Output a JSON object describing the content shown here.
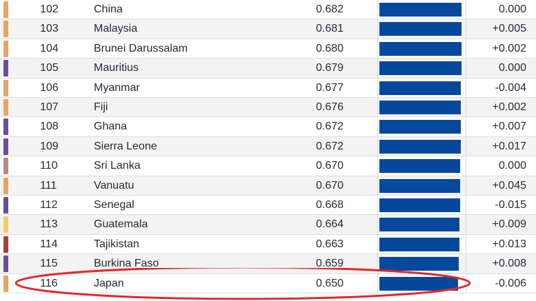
{
  "rows": [
    {
      "rank": "102",
      "country": "China",
      "score": "0.682",
      "change": "0.000",
      "accent": "#e8a65b",
      "bar_fill": 0.682
    },
    {
      "rank": "103",
      "country": "Malaysia",
      "score": "0.681",
      "change": "+0.005",
      "accent": "#e8a65b",
      "bar_fill": 0.681
    },
    {
      "rank": "104",
      "country": "Brunei Darussalam",
      "score": "0.680",
      "change": "+0.002",
      "accent": "#e8a65b",
      "bar_fill": 0.68
    },
    {
      "rank": "105",
      "country": "Mauritius",
      "score": "0.679",
      "change": "0.000",
      "accent": "#6b4e9b",
      "bar_fill": 0.679
    },
    {
      "rank": "106",
      "country": "Myanmar",
      "score": "0.677",
      "change": "-0.004",
      "accent": "#e8a65b",
      "bar_fill": 0.677
    },
    {
      "rank": "107",
      "country": "Fiji",
      "score": "0.676",
      "change": "+0.002",
      "accent": "#e8a65b",
      "bar_fill": 0.676
    },
    {
      "rank": "108",
      "country": "Ghana",
      "score": "0.672",
      "change": "+0.007",
      "accent": "#6b4e9b",
      "bar_fill": 0.672
    },
    {
      "rank": "109",
      "country": "Sierra Leone",
      "score": "0.672",
      "change": "+0.017",
      "accent": "#6b4e9b",
      "bar_fill": 0.672
    },
    {
      "rank": "110",
      "country": "Sri Lanka",
      "score": "0.670",
      "change": "0.000",
      "accent": "#b98a84",
      "bar_fill": 0.67
    },
    {
      "rank": "111",
      "country": "Vanuatu",
      "score": "0.670",
      "change": "+0.045",
      "accent": "#e8a65b",
      "bar_fill": 0.67
    },
    {
      "rank": "112",
      "country": "Senegal",
      "score": "0.668",
      "change": "-0.015",
      "accent": "#6b4e9b",
      "bar_fill": 0.668
    },
    {
      "rank": "113",
      "country": "Guatemala",
      "score": "0.664",
      "change": "+0.009",
      "accent": "#f7cf58",
      "bar_fill": 0.664
    },
    {
      "rank": "114",
      "country": "Tajikistan",
      "score": "0.663",
      "change": "+0.013",
      "accent": "#b33c36",
      "bar_fill": 0.663
    },
    {
      "rank": "115",
      "country": "Burkina Faso",
      "score": "0.659",
      "change": "+0.008",
      "accent": "#6b4e9b",
      "bar_fill": 0.659
    },
    {
      "rank": "116",
      "country": "Japan",
      "score": "0.650",
      "change": "-0.006",
      "accent": "#e8a65b",
      "bar_fill": 0.65
    }
  ],
  "bar_color": "#06489b",
  "highlight_color": "#e5262a"
}
